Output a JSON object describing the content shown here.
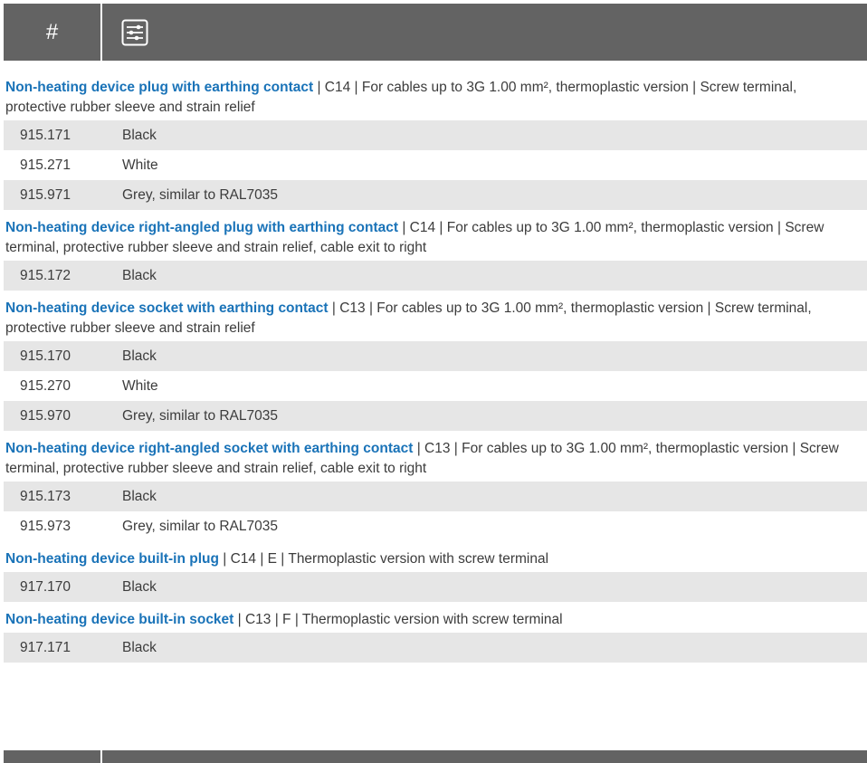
{
  "header": {
    "hash_label": "#",
    "filter_icon": "sliders-icon"
  },
  "sections": [
    {
      "title": "Non-heating device plug with earthing contact",
      "details": " | C14 | For cables up to 3G 1.00 mm², thermoplastic version | Screw terminal, protective rubber sleeve and strain relief",
      "rows": [
        {
          "code": "915.171",
          "desc": "Black",
          "shaded": true
        },
        {
          "code": "915.271",
          "desc": "White",
          "shaded": false
        },
        {
          "code": "915.971",
          "desc": "Grey, similar to RAL7035",
          "shaded": true
        }
      ]
    },
    {
      "title": "Non-heating device right-angled plug with earthing contact",
      "details": " | C14 | For cables up to 3G 1.00 mm², thermoplastic version | Screw terminal, protective rubber sleeve and strain relief, cable exit to right",
      "rows": [
        {
          "code": "915.172",
          "desc": "Black",
          "shaded": true
        }
      ]
    },
    {
      "title": "Non-heating device socket with earthing contact",
      "details": " | C13 | For cables up to 3G 1.00 mm², thermoplastic version | Screw terminal, protective rubber sleeve and strain relief",
      "rows": [
        {
          "code": "915.170",
          "desc": "Black",
          "shaded": true
        },
        {
          "code": "915.270",
          "desc": "White",
          "shaded": false
        },
        {
          "code": "915.970",
          "desc": "Grey, similar to RAL7035",
          "shaded": true
        }
      ]
    },
    {
      "title": "Non-heating device right-angled socket with earthing contact",
      "details": " | C13 | For cables up to 3G 1.00 mm², thermoplastic version | Screw terminal, protective rubber sleeve and strain relief, cable exit to right",
      "rows": [
        {
          "code": "915.173",
          "desc": "Black",
          "shaded": true
        },
        {
          "code": "915.973",
          "desc": "Grey, similar to RAL7035",
          "shaded": false
        }
      ]
    },
    {
      "title": "Non-heating device built-in plug",
      "details": " | C14 | E | Thermoplastic version with screw terminal",
      "rows": [
        {
          "code": "917.170",
          "desc": "Black",
          "shaded": true
        }
      ]
    },
    {
      "title": "Non-heating device built-in socket",
      "details": " | C13 | F | Thermoplastic version with screw terminal",
      "rows": [
        {
          "code": "917.171",
          "desc": "Black",
          "shaded": true
        }
      ]
    }
  ],
  "colors": {
    "header_bg": "#636363",
    "title_blue": "#1a73b8",
    "row_shade": "#e6e6e6"
  }
}
